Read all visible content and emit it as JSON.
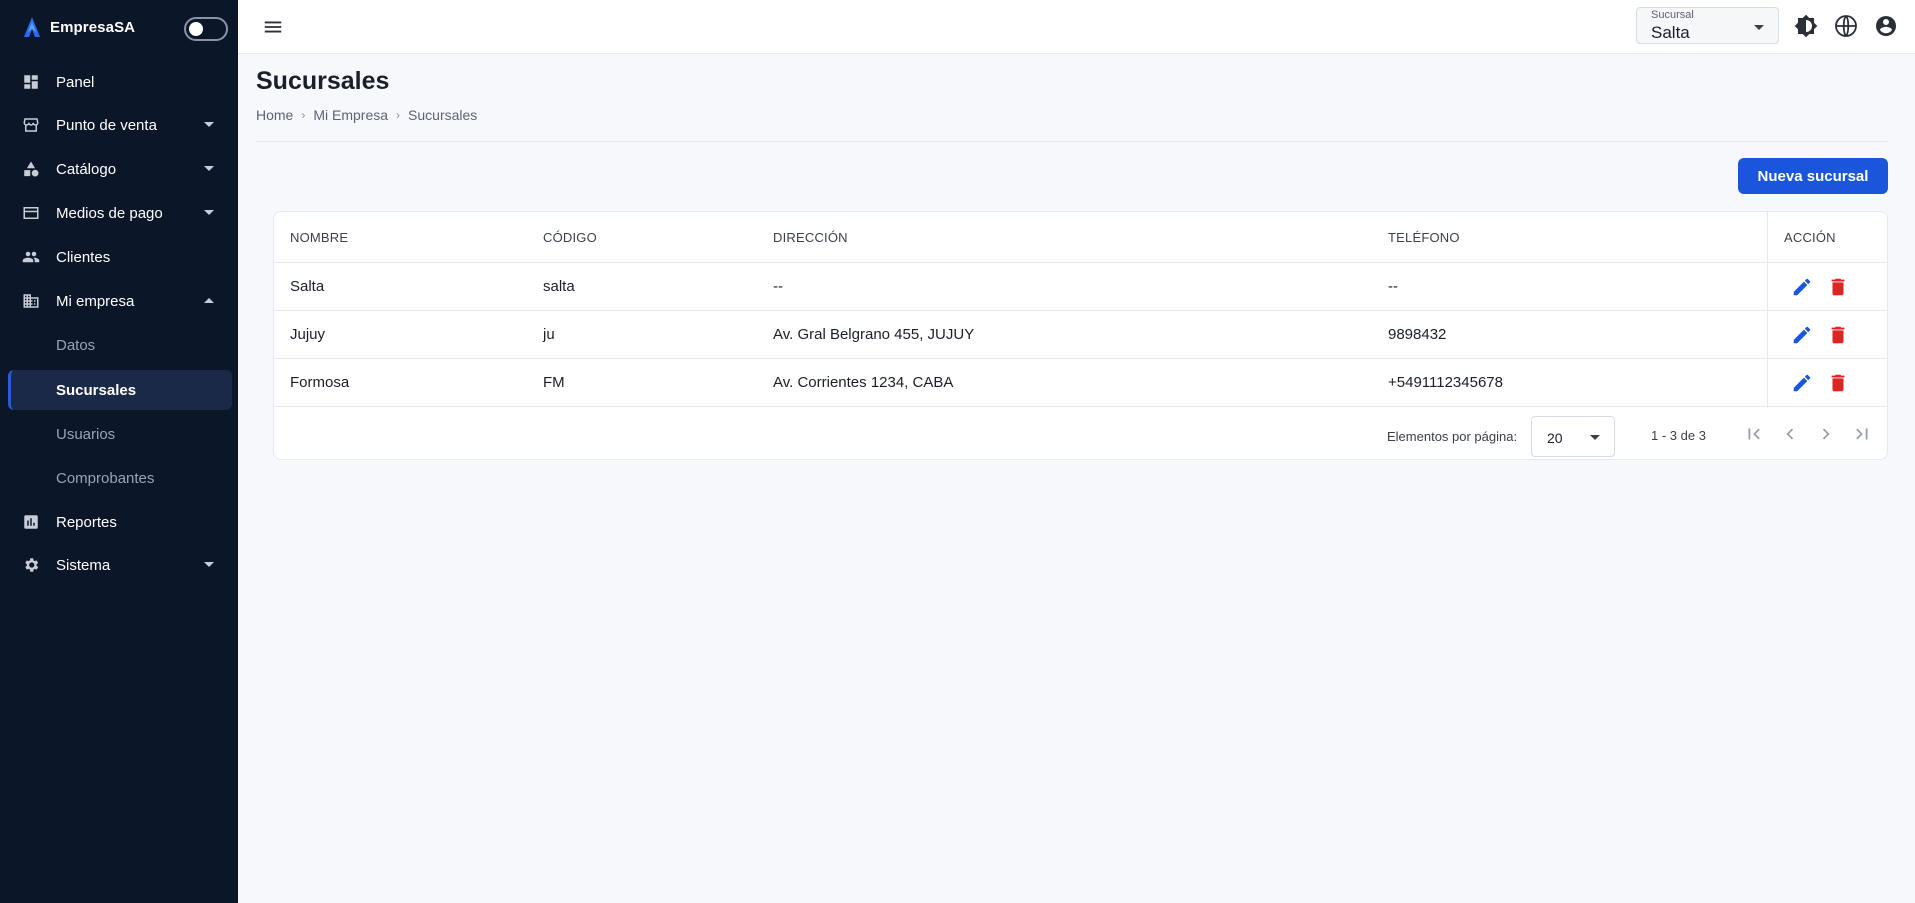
{
  "app": {
    "name": "EmpresaSA"
  },
  "sidebar": {
    "items": [
      {
        "label": "Panel"
      },
      {
        "label": "Punto de venta"
      },
      {
        "label": "Catálogo"
      },
      {
        "label": "Medios de pago"
      },
      {
        "label": "Clientes"
      },
      {
        "label": "Mi empresa"
      },
      {
        "label": "Reportes"
      },
      {
        "label": "Sistema"
      }
    ],
    "sub_items": [
      {
        "label": "Datos"
      },
      {
        "label": "Sucursales"
      },
      {
        "label": "Usuarios"
      },
      {
        "label": "Comprobantes"
      }
    ]
  },
  "topbar": {
    "branch_label": "Sucursal",
    "branch_value": "Salta",
    "icons": [
      "brightness-icon",
      "globe-icon",
      "account-icon"
    ]
  },
  "page": {
    "title": "Sucursales",
    "breadcrumb": [
      "Home",
      "Mi Empresa",
      "Sucursales"
    ],
    "new_button": "Nueva sucursal"
  },
  "table": {
    "headers": [
      "NOMBRE",
      "CÓDIGO",
      "DIRECCIÓN",
      "TELÉFONO",
      "ACCIÓN"
    ],
    "rows": [
      [
        "Salta",
        "salta",
        "--",
        "--"
      ],
      [
        "Jujuy",
        "ju",
        "Av. Gral Belgrano 455, JUJUY",
        "9898432"
      ],
      [
        "Formosa",
        "FM",
        "Av. Corrientes 1234, CABA",
        "+5491112345678"
      ]
    ]
  },
  "pager": {
    "per_page_label": "Elementos por página:",
    "per_page_value": "20",
    "range": "1 - 3 de 3"
  },
  "colors": {
    "sidebar_bg": "#0c1629",
    "primary": "#1a56db",
    "edit": "#1a56db",
    "delete": "#e02424"
  }
}
